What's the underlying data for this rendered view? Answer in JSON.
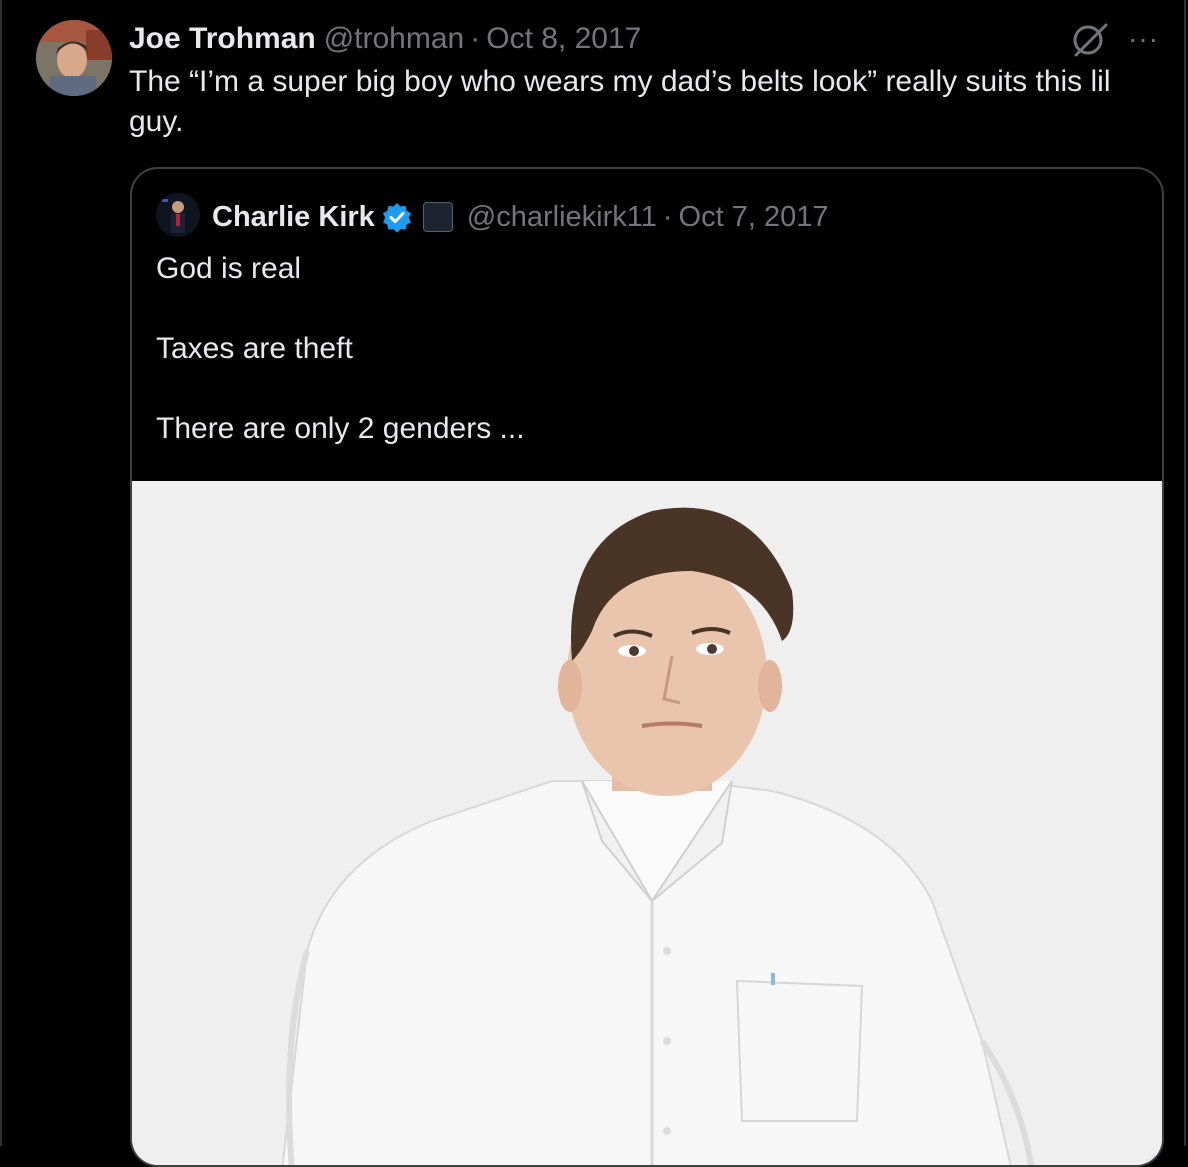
{
  "tweet": {
    "author_name": "Joe Trohman",
    "author_handle": "@trohman",
    "separator": "·",
    "date": "Oct 8, 2017",
    "text": "The “I’m a super big boy who wears my dad’s belts look” really suits this lil guy.",
    "more_label": "···",
    "icons": {
      "avatar": "profile-photo-icon",
      "grok": "grok-icon",
      "more": "more-options-icon"
    }
  },
  "quote": {
    "author_name": "Charlie Kirk",
    "author_handle": "@charliekirk11",
    "separator": "·",
    "date": "Oct 7, 2017",
    "lines": [
      "God is real",
      "Taxes are theft",
      "There are only 2 genders ..."
    ],
    "icons": {
      "verified": "verified-badge-icon",
      "affiliation": "affiliation-badge-icon"
    },
    "media_alt": "Photo of a man in a white button-down shirt with hands on hips"
  },
  "colors": {
    "background": "#000000",
    "text": "#e7e9ea",
    "muted": "#71767b",
    "border": "#2f3336",
    "verified": "#1d9bf0"
  }
}
